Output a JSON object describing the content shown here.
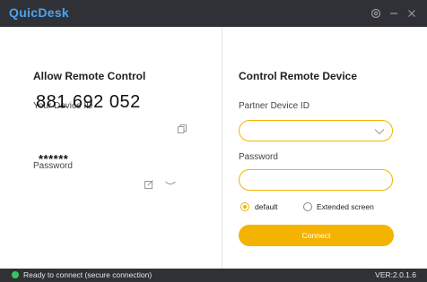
{
  "app": {
    "title": "QuicDesk"
  },
  "window_controls": {
    "settings_icon": "gear-icon",
    "minimize_icon": "minimize-icon",
    "close_icon": "close-icon"
  },
  "allow_panel": {
    "heading": "Allow Remote Control",
    "device_id_label": "Your Device ID",
    "device_id": "881 692 052",
    "password_label": "Password",
    "password_mask": "******",
    "copy_icon": "copy-icon",
    "edit_icon": "edit-icon",
    "expand_icon": "chevron-down-icon"
  },
  "control_panel": {
    "heading": "Control Remote Device",
    "partner_label": "Partner Device ID",
    "partner_value": "",
    "password_label": "Password",
    "password_value": "",
    "options": [
      {
        "label": "default",
        "selected": true
      },
      {
        "label": "Extended screen",
        "selected": false
      }
    ],
    "connect_label": "Connect"
  },
  "status": {
    "text": "Ready to connect (secure connection)",
    "version": "VER:2.0.1.6"
  },
  "colors": {
    "accent": "#f5b301",
    "titlebar": "#303136",
    "brand": "#4aa3f0",
    "status_ok": "#38c55e"
  }
}
